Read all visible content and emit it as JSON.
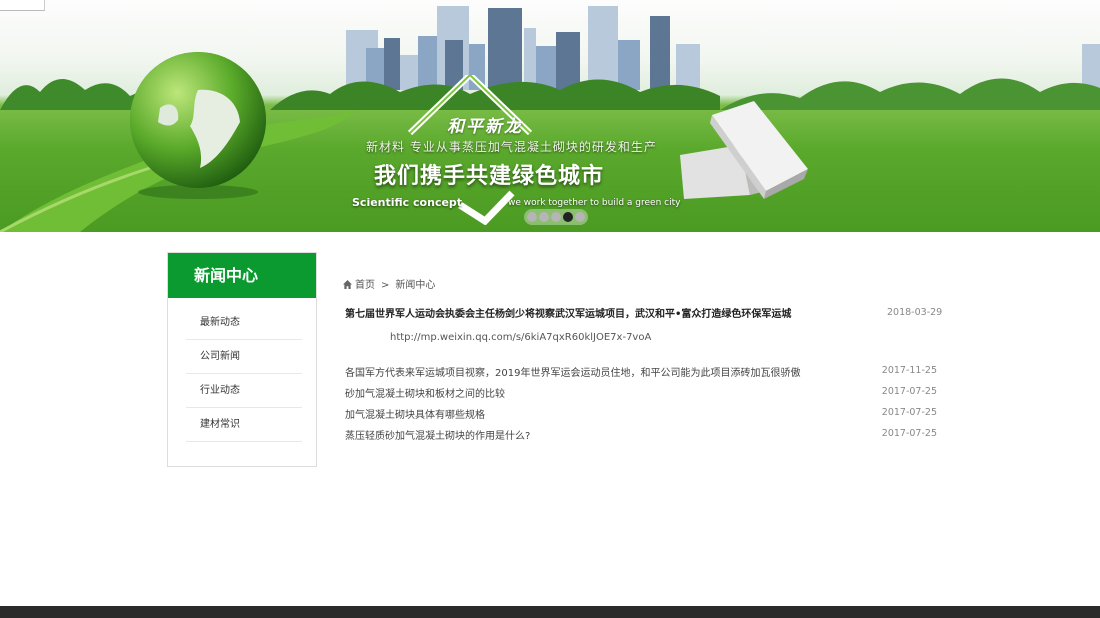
{
  "banner": {
    "brand": "和平新龙",
    "subtitle": "新材料 专业从事蒸压加气混凝土砌块的研发和生产",
    "slogan": "我们携手共建绿色城市",
    "concept": "Scientific concept",
    "together": "we work together to build a green city",
    "slides": 5,
    "active_slide": 4
  },
  "sidebar": {
    "title": "新闻中心",
    "items": [
      {
        "label": "最新动态"
      },
      {
        "label": "公司新闻"
      },
      {
        "label": "行业动态"
      },
      {
        "label": "建材常识"
      }
    ]
  },
  "breadcrumb": {
    "home": "首页",
    "separator": ">",
    "current": "新闻中心"
  },
  "featured": {
    "title": "第七届世界军人运动会执委会主任杨剑少将视察武汉军运城项目，武汉和平•富众打造绿色环保军运城",
    "date": "2018-03-29",
    "url": "http://mp.weixin.qq.com/s/6kiA7qxR60klJOE7x-7voA"
  },
  "news": [
    {
      "title": "各国军方代表来军运城项目视察，2019年世界军运会运动员住地，和平公司能为此项目添砖加瓦很骄傲",
      "date": "2017-11-25"
    },
    {
      "title": "砂加气混凝土砌块和板材之间的比较",
      "date": "2017-07-25"
    },
    {
      "title": "加气混凝土砌块具体有哪些规格",
      "date": "2017-07-25"
    },
    {
      "title": "蒸压轻质砂加气混凝土砌块的作用是什么?",
      "date": "2017-07-25"
    }
  ],
  "colors": {
    "accent_green": "#0a9a2f",
    "footer": "#2b2b2b"
  }
}
